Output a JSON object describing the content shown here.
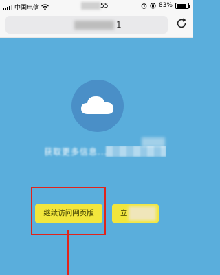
{
  "status_bar": {
    "carrier": "中国电信",
    "time_visible": "55",
    "battery": "83%",
    "battery_level": 0.83
  },
  "browser": {
    "url_visible": "1"
  },
  "page": {
    "message": "获取更多信息..."
  },
  "buttons": {
    "web_label": "继续访问网页版",
    "app_label": "立"
  },
  "colors": {
    "background": "#5aaedc",
    "circle": "#4a8fc7",
    "button": "#f2e63c",
    "annotation": "#e0241b"
  },
  "icons": [
    "wifi-icon",
    "reload-icon",
    "cloud-icon",
    "alarm-icon",
    "lock-rotation-icon"
  ]
}
